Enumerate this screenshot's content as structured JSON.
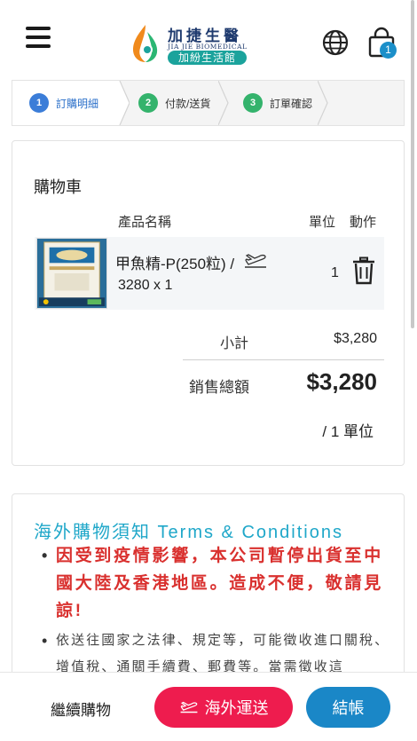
{
  "header": {
    "brand_title": "加捷生醫",
    "brand_subtitle": "JIA JIE BIOMEDICAL",
    "brand_pill": "加紛生活館",
    "cart_count": "1"
  },
  "steps": [
    {
      "num": "1",
      "label": "訂購明細"
    },
    {
      "num": "2",
      "label": "付款/送貨"
    },
    {
      "num": "3",
      "label": "訂單確認"
    }
  ],
  "cart": {
    "title": "購物車",
    "col_product": "產品名稱",
    "col_unit": "單位",
    "col_action": "動作",
    "items": [
      {
        "name": "甲魚精-P(250粒)",
        "separator": "/",
        "price_qty": "3280 x 1",
        "units": "1"
      }
    ],
    "subtotal_label": "小計",
    "subtotal_value": "$3,280",
    "total_label": "銷售總額",
    "total_value": "$3,280",
    "total_units": "/ 1 單位"
  },
  "terms": {
    "title": "海外購物須知 Terms & Conditions",
    "items": [
      "因受到疫情影響，本公司暫停出貨至中國大陸及香港地區。造成不便，敬請見諒!",
      "依送往國家之法律、規定等，可能徵收進口關稅、增值稅、通關手續費、郵費等。當需徵收這"
    ]
  },
  "footer": {
    "continue_label": "繼續購物",
    "overseas_label": "海外運送",
    "checkout_label": "結帳"
  },
  "colors": {
    "step_active": "#3b7dd8",
    "step_inactive": "#34b36c",
    "terms_title": "#1fa7c9",
    "terms_warning": "#d9302e",
    "overseas_button": "#ee1c4e",
    "checkout_button": "#1a87c7",
    "cart_badge": "#1b8fc9"
  },
  "icons": [
    "menu-icon",
    "globe-icon",
    "shopping-bag-icon",
    "airplane-icon",
    "trash-icon"
  ]
}
